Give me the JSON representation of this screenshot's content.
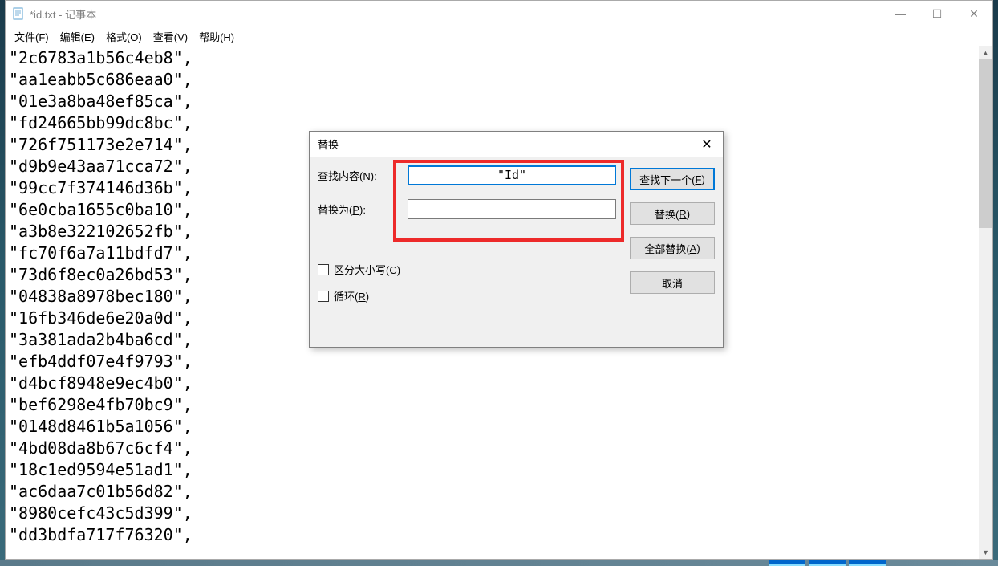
{
  "window": {
    "title": "*id.txt - 记事本",
    "controls": {
      "minimize": "—",
      "maximize": "☐",
      "close": "✕"
    }
  },
  "menubar": {
    "items": [
      {
        "label": "文件(F)"
      },
      {
        "label": "编辑(E)"
      },
      {
        "label": "格式(O)"
      },
      {
        "label": "查看(V)"
      },
      {
        "label": "帮助(H)"
      }
    ]
  },
  "content": {
    "lines": [
      "\"2c6783a1b56c4eb8\",",
      "\"aa1eabb5c686eaa0\",",
      "\"01e3a8ba48ef85ca\",",
      "\"fd24665bb99dc8bc\",",
      "\"726f751173e2e714\",",
      "\"d9b9e43aa71cca72\",",
      "\"99cc7f374146d36b\",",
      "\"6e0cba1655c0ba10\",",
      "\"a3b8e322102652fb\",",
      "\"fc70f6a7a11bdfd7\",",
      "\"73d6f8ec0a26bd53\",",
      "\"04838a8978bec180\",",
      "\"16fb346de6e20a0d\",",
      "\"3a381ada2b4ba6cd\",",
      "\"efb4ddf07e4f9793\",",
      "\"d4bcf8948e9ec4b0\",",
      "\"bef6298e4fb70bc9\",",
      "\"0148d8461b5a1056\",",
      "\"4bd08da8b67c6cf4\",",
      "\"18c1ed9594e51ad1\",",
      "\"ac6daa7c01b56d82\",",
      "\"8980cefc43c5d399\",",
      "\"dd3bdfa717f76320\","
    ]
  },
  "dialog": {
    "title": "替换",
    "close": "✕",
    "find_label_pre": "查找内容(",
    "find_label_key": "N",
    "find_label_post": "):",
    "find_value": "\"Id\"",
    "replace_label_pre": "替换为(",
    "replace_label_key": "P",
    "replace_label_post": "):",
    "replace_value": "",
    "buttons": {
      "find_next_pre": "查找下一个(",
      "find_next_key": "F",
      "find_next_post": ")",
      "replace_pre": "替换(",
      "replace_key": "R",
      "replace_post": ")",
      "replace_all_pre": "全部替换(",
      "replace_all_key": "A",
      "replace_all_post": ")",
      "cancel": "取消"
    },
    "match_case_pre": "区分大小写(",
    "match_case_key": "C",
    "match_case_post": ")",
    "wrap_pre": "循环(",
    "wrap_key": "R",
    "wrap_post": ")"
  }
}
